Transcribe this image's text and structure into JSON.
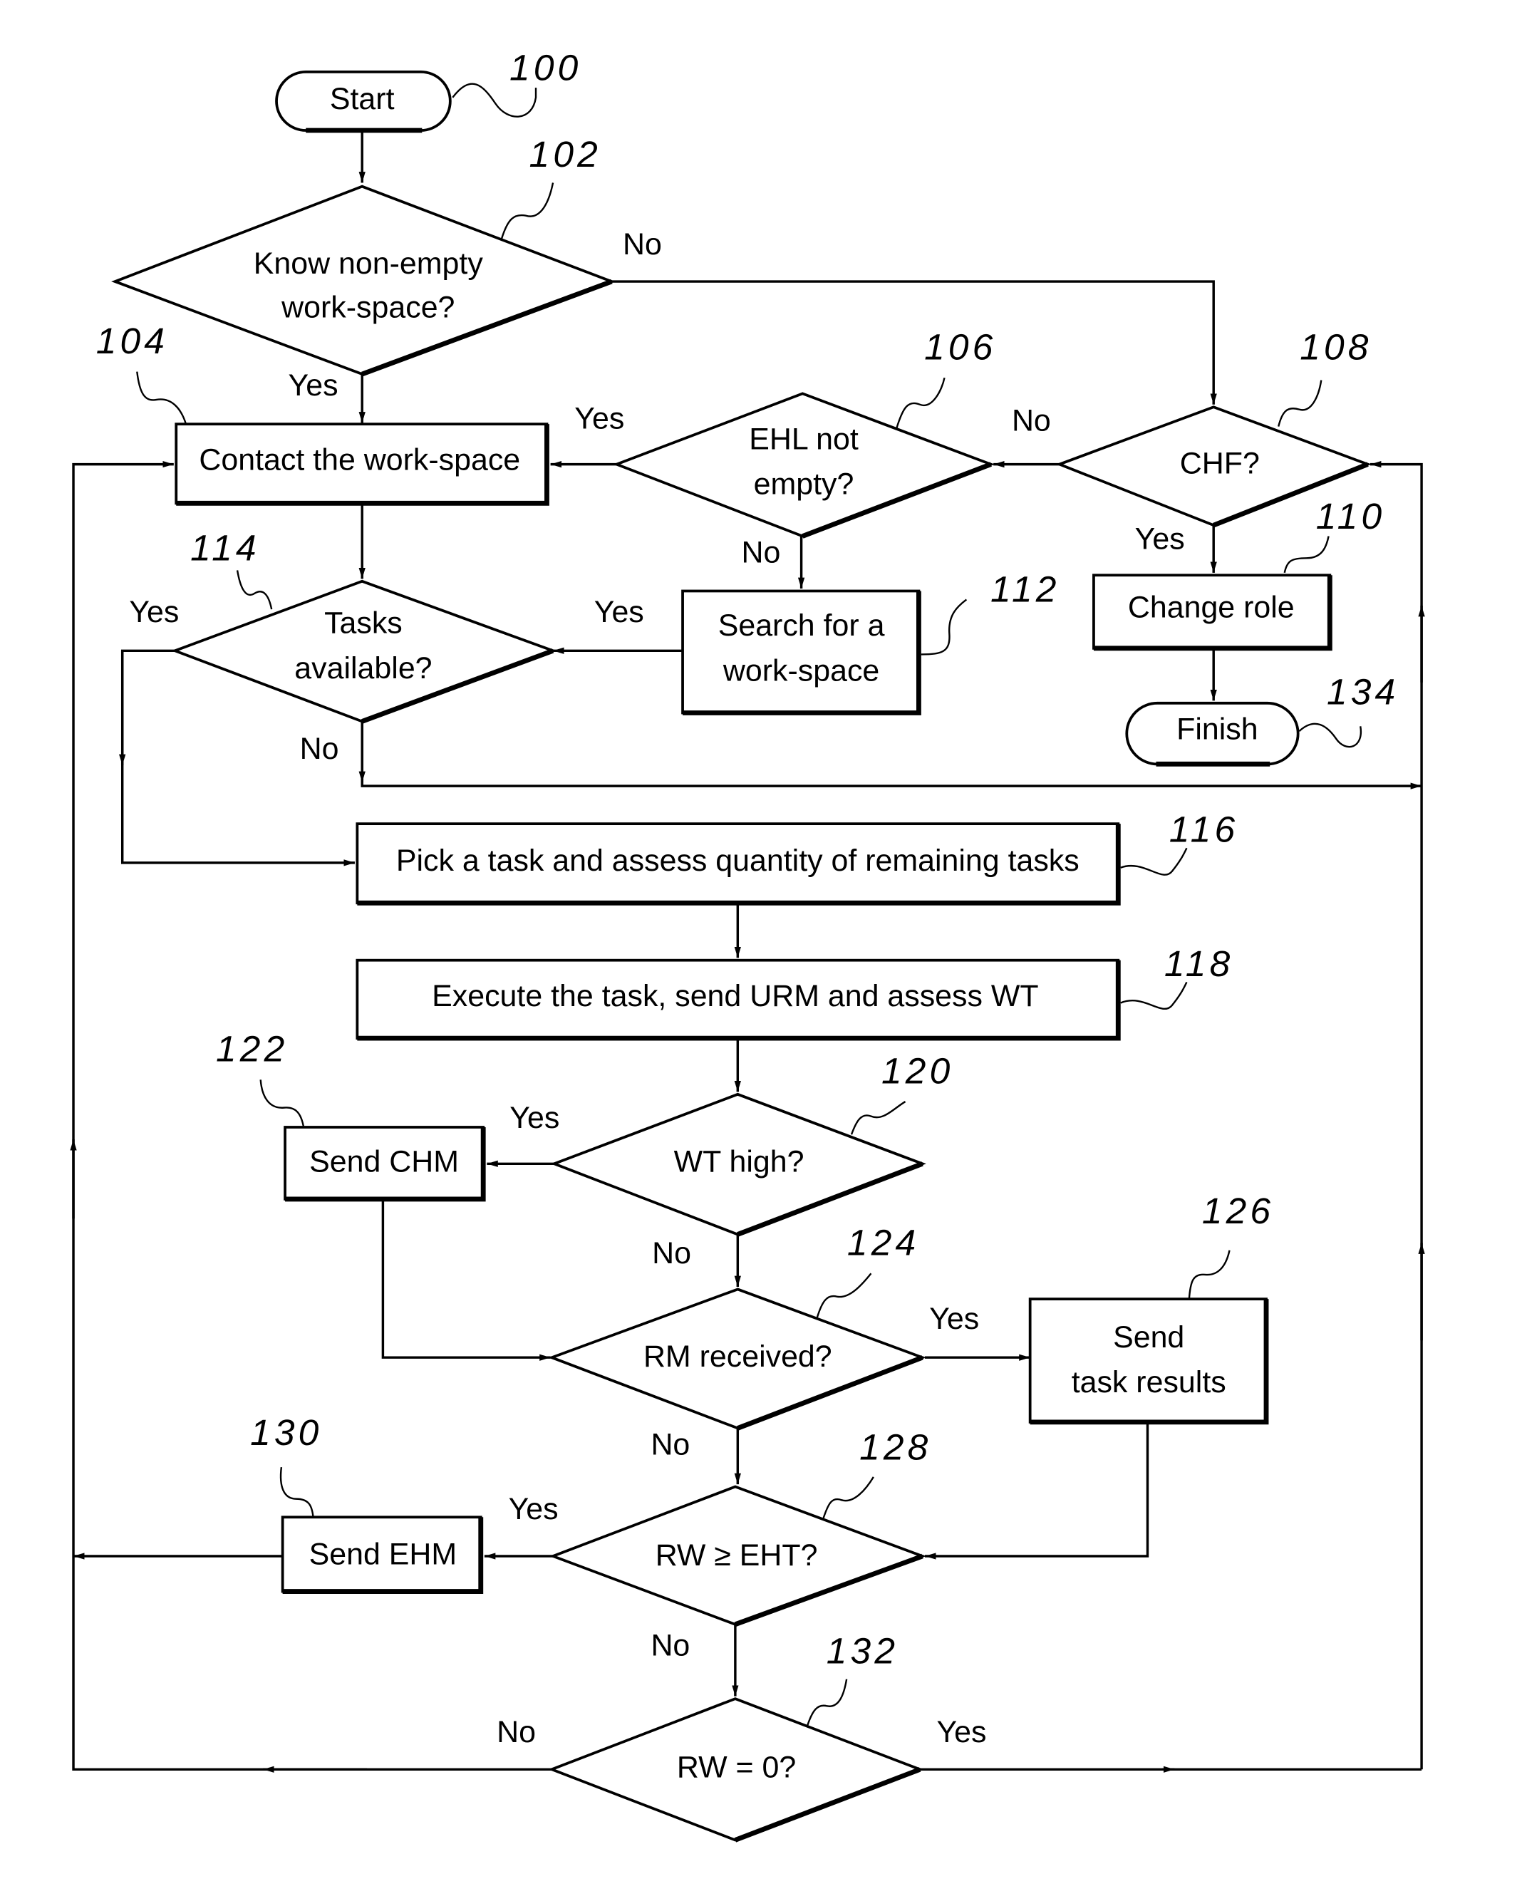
{
  "diagram": {
    "type": "flowchart",
    "nodes": {
      "start": {
        "ref": "100",
        "label": "Start"
      },
      "know_ws": {
        "ref": "102",
        "line1": "Know non-empty",
        "line2": "work-space?"
      },
      "contact": {
        "ref": "104",
        "label": "Contact the work-space"
      },
      "ehl": {
        "ref": "106",
        "line1": "EHL not",
        "line2": "empty?"
      },
      "chf": {
        "ref": "108",
        "label": "CHF?"
      },
      "change_role": {
        "ref": "110",
        "label": "Change role"
      },
      "search": {
        "ref": "112",
        "line1": "Search for a",
        "line2": "work-space"
      },
      "tasks": {
        "ref": "114",
        "line1": "Tasks",
        "line2": "available?"
      },
      "pick": {
        "ref": "116",
        "label": "Pick a task and assess quantity of remaining tasks"
      },
      "execute": {
        "ref": "118",
        "label": "Execute the task, send URM and assess WT"
      },
      "wt_high": {
        "ref": "120",
        "label": "WT high?"
      },
      "send_chm": {
        "ref": "122",
        "label": "Send CHM"
      },
      "rm_received": {
        "ref": "124",
        "label": "RM  received?"
      },
      "send_results": {
        "ref": "126",
        "line1": "Send",
        "line2": "task results"
      },
      "rw_eht": {
        "ref": "128",
        "label": "RW ≥ EHT?"
      },
      "send_ehm": {
        "ref": "130",
        "label": "Send EHM"
      },
      "rw_zero": {
        "ref": "132",
        "label": "RW = 0?"
      },
      "finish": {
        "ref": "134",
        "label": "Finish"
      }
    },
    "edge_labels": {
      "know_no": "No",
      "know_yes": "Yes",
      "ehl_yes": "Yes",
      "ehl_no": "No",
      "chf_no": "No",
      "chf_yes": "Yes",
      "search_yes": "Yes",
      "tasks_yes": "Yes",
      "tasks_no": "No",
      "wt_yes": "Yes",
      "wt_no": "No",
      "rm_yes": "Yes",
      "rm_no": "No",
      "eht_yes": "Yes",
      "eht_no": "No",
      "zero_no": "No",
      "zero_yes": "Yes"
    }
  }
}
